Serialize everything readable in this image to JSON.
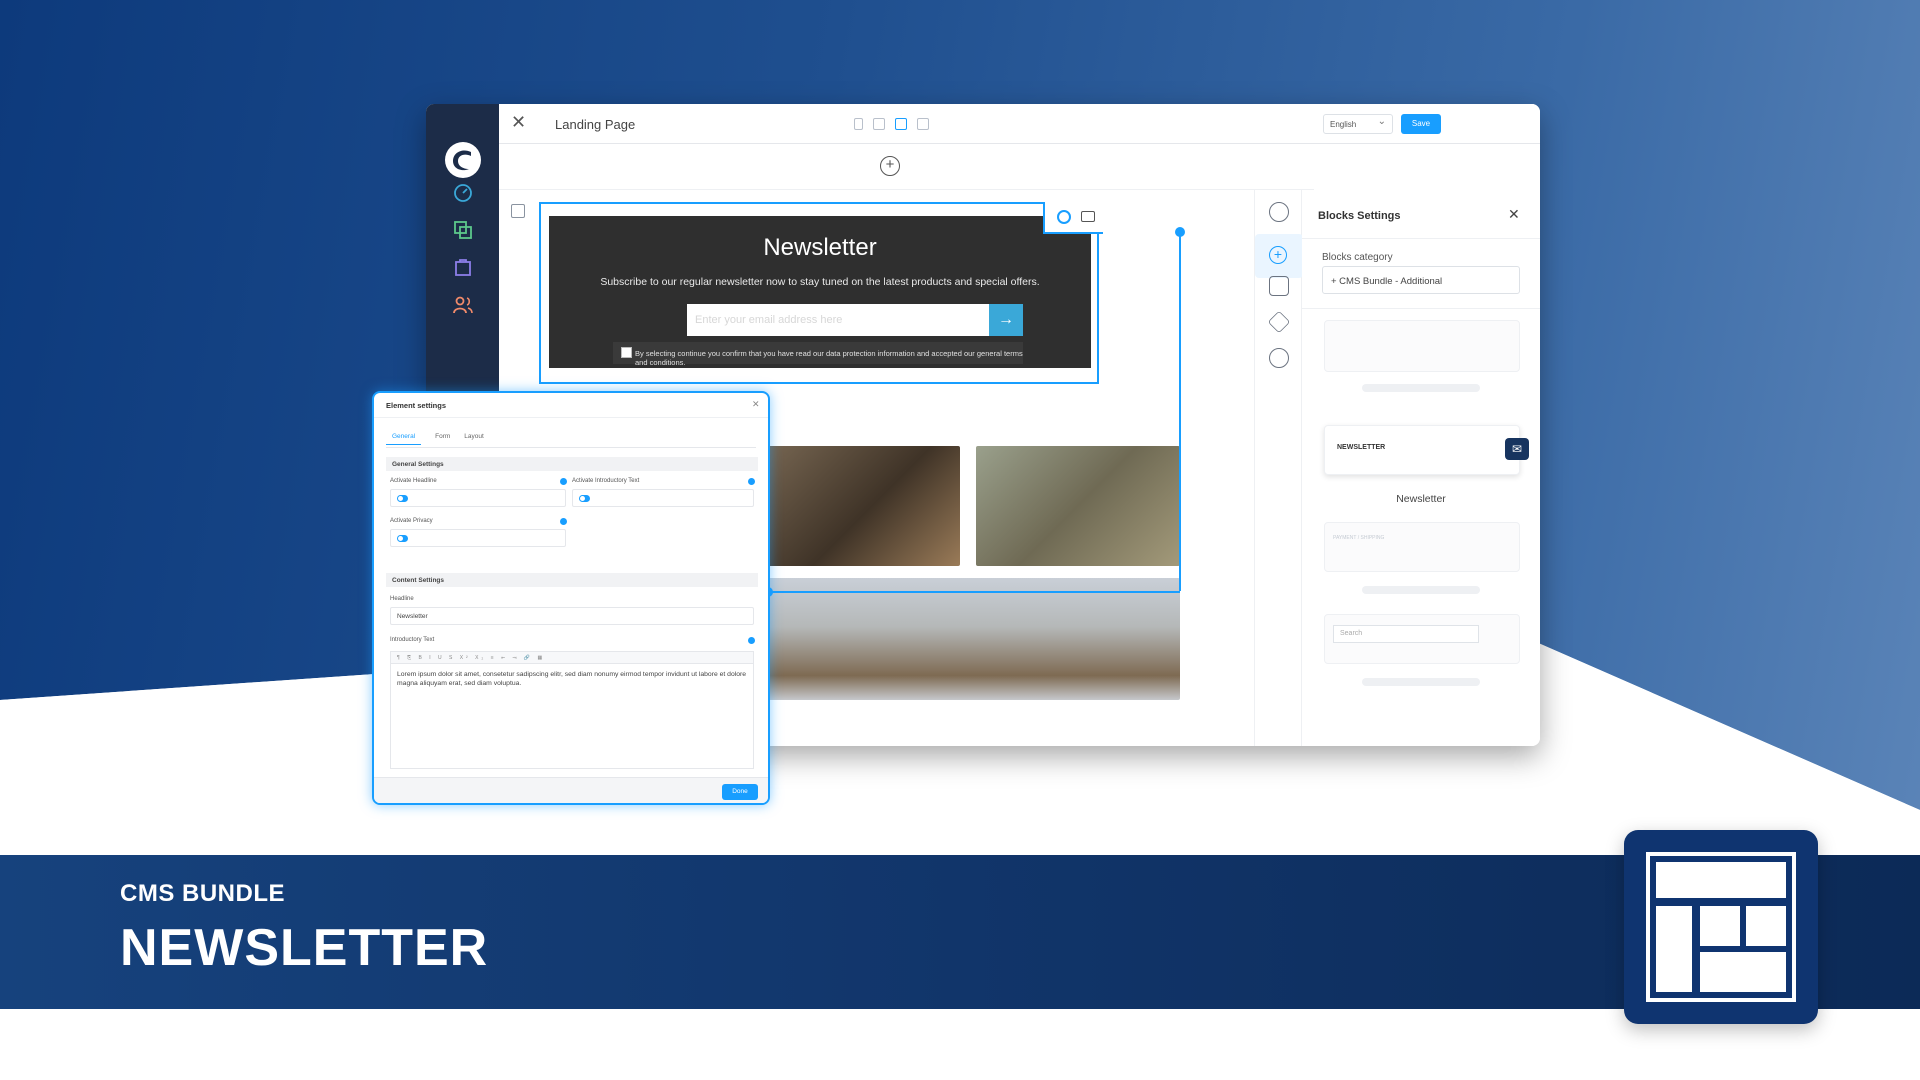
{
  "footer": {
    "subtitle": "CMS BUNDLE",
    "title": "NEWSLETTER"
  },
  "app": {
    "page_name": "Landing Page",
    "language": "English",
    "save_label": "Save"
  },
  "newsletter_block": {
    "title": "Newsletter",
    "subtitle": "Subscribe to our regular newsletter now to stay tuned on the latest products and special offers.",
    "email_placeholder": "Enter your email address here",
    "privacy_text": "By selecting continue you confirm that you have read our data protection information and accepted our general terms and conditions."
  },
  "blocks_panel": {
    "title": "Blocks Settings",
    "category_label": "Blocks category",
    "category_value": "+ CMS Bundle - Additional",
    "newsletter_tile_label": "NEWSLETTER",
    "newsletter_caption": "Newsletter",
    "payment_tile_label": "PAYMENT / SHIPPING",
    "search_placeholder": "Search"
  },
  "element_settings": {
    "title": "Element settings",
    "tabs": [
      "General",
      "Form",
      "Layout"
    ],
    "general_section": "General Settings",
    "activate_headline": "Activate Headline",
    "activate_intro": "Activate Introductory Text",
    "activate_privacy": "Activate Privacy",
    "content_section": "Content Settings",
    "headline_label": "Headline",
    "headline_value": "Newsletter",
    "intro_label": "Introductory Text",
    "intro_text": "Lorem ipsum dolor sit amet, consetetur sadipscing elitr, sed diam nonumy eirmod tempor invidunt ut labore et dolore magna aliquyam erat, sed diam voluptua.",
    "done_label": "Done"
  },
  "colors": {
    "accent": "#189eff",
    "sidebar": "#1c2c48",
    "brand_dark": "#0f3470"
  },
  "icons": [
    "shopware-logo-icon",
    "dashboard-icon",
    "catalog-icon",
    "orders-icon",
    "customers-icon",
    "close-icon",
    "mobile-icon",
    "tablet-icon",
    "desktop-icon",
    "list-icon",
    "add-section-icon",
    "layout-icon",
    "gear-icon",
    "swap-icon",
    "arrow-right-icon",
    "settings-icon",
    "add-block-icon",
    "edit-icon",
    "layers-icon",
    "share-icon",
    "mail-icon",
    "cms-layout-icon"
  ]
}
